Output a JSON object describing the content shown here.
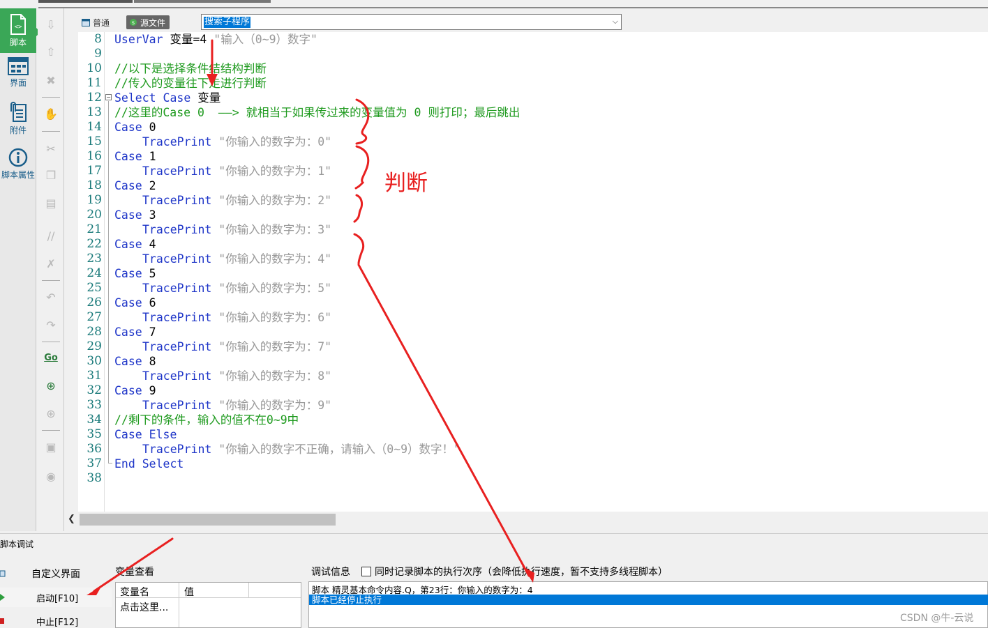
{
  "sidebar": {
    "items": [
      {
        "label": "脚本",
        "icon": "script-icon"
      },
      {
        "label": "界面",
        "icon": "layout-icon"
      },
      {
        "label": "附件",
        "icon": "attachment-icon"
      },
      {
        "label": "脚本属性",
        "icon": "info-icon"
      }
    ]
  },
  "tabs": {
    "normal": "普通",
    "source": "源文件"
  },
  "search": {
    "value": "搜索子程序"
  },
  "editor": {
    "lines": [
      {
        "num": "8",
        "text": ""
      },
      {
        "num": "9",
        "text": ""
      },
      {
        "num": "10",
        "text": ""
      },
      {
        "num": "11",
        "text": ""
      },
      {
        "num": "12",
        "text": ""
      },
      {
        "num": "13",
        "text": ""
      },
      {
        "num": "14",
        "text": ""
      },
      {
        "num": "15",
        "text": ""
      },
      {
        "num": "16",
        "text": ""
      },
      {
        "num": "17",
        "text": ""
      },
      {
        "num": "18",
        "text": ""
      },
      {
        "num": "19",
        "text": ""
      },
      {
        "num": "20",
        "text": ""
      },
      {
        "num": "21",
        "text": ""
      },
      {
        "num": "22",
        "text": ""
      },
      {
        "num": "23",
        "text": ""
      },
      {
        "num": "24",
        "text": ""
      },
      {
        "num": "25",
        "text": ""
      },
      {
        "num": "26",
        "text": ""
      },
      {
        "num": "27",
        "text": ""
      },
      {
        "num": "28",
        "text": ""
      },
      {
        "num": "29",
        "text": ""
      },
      {
        "num": "30",
        "text": ""
      },
      {
        "num": "31",
        "text": ""
      },
      {
        "num": "32",
        "text": ""
      },
      {
        "num": "33",
        "text": ""
      },
      {
        "num": "34",
        "text": ""
      },
      {
        "num": "35",
        "text": ""
      },
      {
        "num": "36",
        "text": ""
      },
      {
        "num": "37",
        "text": ""
      },
      {
        "num": "38",
        "text": ""
      }
    ],
    "code": {
      "l8_kw": "UserVar",
      "l8_var": " 变量=4 ",
      "l8_str": "\"输入（0~9）数字\"",
      "l10": "//以下是选择条件结结构判断",
      "l11": "//传入的变量往下走进行判断",
      "l12_kw": "Select Case",
      "l12_var": " 变量",
      "l13": "//这里的Case 0  ——> 就相当于如果传过来的变量值为 0 则打印；最后跳出",
      "case_kw": "Case",
      "trace_kw": "TracePrint",
      "cases": [
        {
          "n": " 0",
          "msg": " \"你输入的数字为：0\""
        },
        {
          "n": " 1",
          "msg": " \"你输入的数字为：1\""
        },
        {
          "n": " 2",
          "msg": " \"你输入的数字为：2\""
        },
        {
          "n": " 3",
          "msg": " \"你输入的数字为：3\""
        },
        {
          "n": " 4",
          "msg": " \"你输入的数字为：4\""
        },
        {
          "n": " 5",
          "msg": " \"你输入的数字为：5\""
        },
        {
          "n": " 6",
          "msg": " \"你输入的数字为：6\""
        },
        {
          "n": " 7",
          "msg": " \"你输入的数字为：7\""
        },
        {
          "n": " 8",
          "msg": " \"你输入的数字为：8\""
        },
        {
          "n": " 9",
          "msg": " \"你输入的数字为：9\""
        }
      ],
      "l34": "//剩下的条件，输入的值不在0~9中",
      "l35_kw": "Case Else",
      "l36_str": " \"你输入的数字不正确，请输入（0~9）数字！\"",
      "l37_kw": "End Select"
    }
  },
  "annotation": {
    "label": "判断"
  },
  "debug": {
    "title": "脚本调试",
    "items": [
      {
        "label": "自定义界面"
      },
      {
        "label": "启动[F10]"
      },
      {
        "label": "中止[F12]"
      }
    ],
    "var_view": "变量查看",
    "var_col_name": "变量名",
    "var_col_value": "值",
    "var_row": "点击这里...",
    "info_label": "调试信息",
    "record_label": "同时记录脚本的执行次序（会降低执行速度，暂不支持多线程脚本）",
    "output": [
      "脚本 精灵基本命令内容.Q，第23行：你输入的数字为：4",
      "脚本已经停止执行"
    ]
  },
  "watermark": "CSDN @牛-云说",
  "colors": {
    "accent_green": "#3aa757",
    "keyword_blue": "#1e35c8",
    "comment_green": "#1e9a1e",
    "string_gray": "#999999",
    "annotation_red": "#e82020",
    "selection_blue": "#0078d7"
  }
}
